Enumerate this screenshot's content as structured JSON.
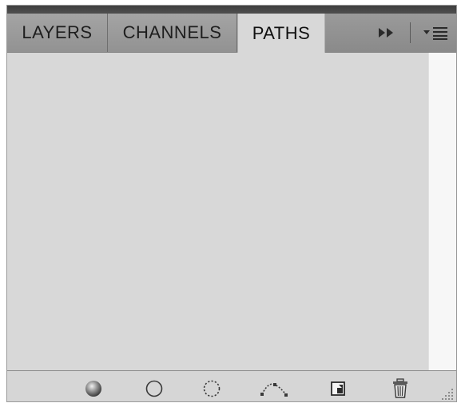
{
  "tabs": [
    {
      "label": "LAYERS",
      "active": false
    },
    {
      "label": "CHANNELS",
      "active": false
    },
    {
      "label": "PATHS",
      "active": true
    }
  ],
  "panel": {
    "collapse_icon": "double-arrow-right-icon",
    "menu_icon": "panel-menu-icon",
    "bottom_buttons": [
      {
        "icon": "fill-path-icon"
      },
      {
        "icon": "stroke-path-icon"
      },
      {
        "icon": "load-path-as-selection-icon"
      },
      {
        "icon": "make-work-path-icon"
      },
      {
        "icon": "create-new-path-icon"
      },
      {
        "icon": "delete-path-icon"
      }
    ]
  },
  "colors": {
    "panel_bg": "#d8d8d8",
    "tab_bg": "#969696",
    "top_strip": "#444444"
  }
}
